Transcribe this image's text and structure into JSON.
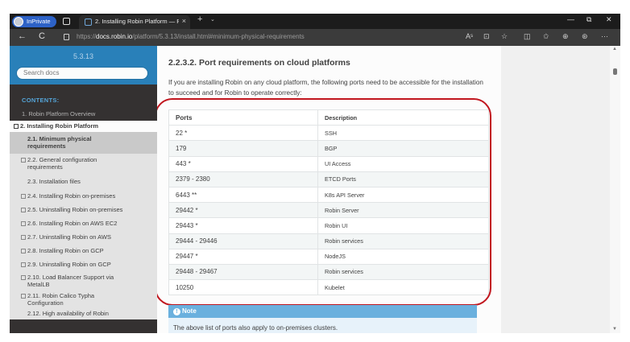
{
  "browser": {
    "inprivate_label": "InPrivate",
    "tab_title": "2. Installing Robin Platform — Ro",
    "url_prefix": "https://",
    "url_domain": "docs.robin.io",
    "url_path": "/platform/5.3.13/install.html#minimum-physical-requirements",
    "new_tab": "+",
    "tab_close": "×",
    "tab_dropdown": "⌄",
    "back": "←",
    "reload": "C",
    "min": "—",
    "restore": "⧉",
    "close": "✕",
    "tools": [
      "Aˢ",
      "⊡",
      "☆",
      "◫",
      "✩",
      "⊕",
      "⊛",
      "···"
    ]
  },
  "sidebar": {
    "version": "5.3.13",
    "search_placeholder": "Search docs",
    "contents_label": "CONTENTS:",
    "items": [
      {
        "label": "1. Robin Platform Overview"
      },
      {
        "label": "2. Installing Robin Platform"
      },
      {
        "label": "2.1. Minimum physical"
      },
      {
        "label": "requirements"
      },
      {
        "label": "2.2. General configuration"
      },
      {
        "label": "requirements"
      },
      {
        "label": "2.3. Installation files"
      },
      {
        "label": "2.4. Installing Robin on-premises"
      },
      {
        "label": "2.5. Uninstalling Robin on-premises"
      },
      {
        "label": "2.6. Installing Robin on AWS EC2"
      },
      {
        "label": "2.7. Uninstalling Robin on AWS"
      },
      {
        "label": "2.8. Installing Robin on GCP"
      },
      {
        "label": "2.9. Uninstalling Robin on GCP"
      },
      {
        "label": "2.10. Load Balancer Support via"
      },
      {
        "label": "MetalLB"
      },
      {
        "label": "2.11. Robin Calico Typha"
      },
      {
        "label": "Configuration"
      },
      {
        "label": "2.12. High availability of Robin"
      }
    ]
  },
  "main": {
    "heading": "2.2.3.2. Port requirements on cloud platforms",
    "intro": "If you are installing Robin on any cloud platform, the following ports need to be accessible for the installation to succeed and for Robin to operate correctly:",
    "table": {
      "headers": [
        "Ports",
        "Description"
      ],
      "rows": [
        [
          "22 *",
          "SSH"
        ],
        [
          "179",
          "BGP"
        ],
        [
          "443 *",
          "UI Access"
        ],
        [
          "2379 - 2380",
          "ETCD Ports"
        ],
        [
          "6443 **",
          "K8s API Server"
        ],
        [
          "29442 *",
          "Robin Server"
        ],
        [
          "29443 *",
          "Robin UI"
        ],
        [
          "29444 - 29446",
          "Robin services"
        ],
        [
          "29447 *",
          "NodeJS"
        ],
        [
          "29448 - 29467",
          "Robin services"
        ],
        [
          "10250",
          "Kubelet"
        ]
      ]
    },
    "note_title": "Note",
    "note_icon": "!",
    "note_text": "The above list of ports also apply to on-premises clusters."
  },
  "colors": {
    "sidebar_bg": "#343131",
    "sidebar_header": "#2980b9",
    "note_header": "#6ab0de",
    "highlight": "#c1161e"
  }
}
